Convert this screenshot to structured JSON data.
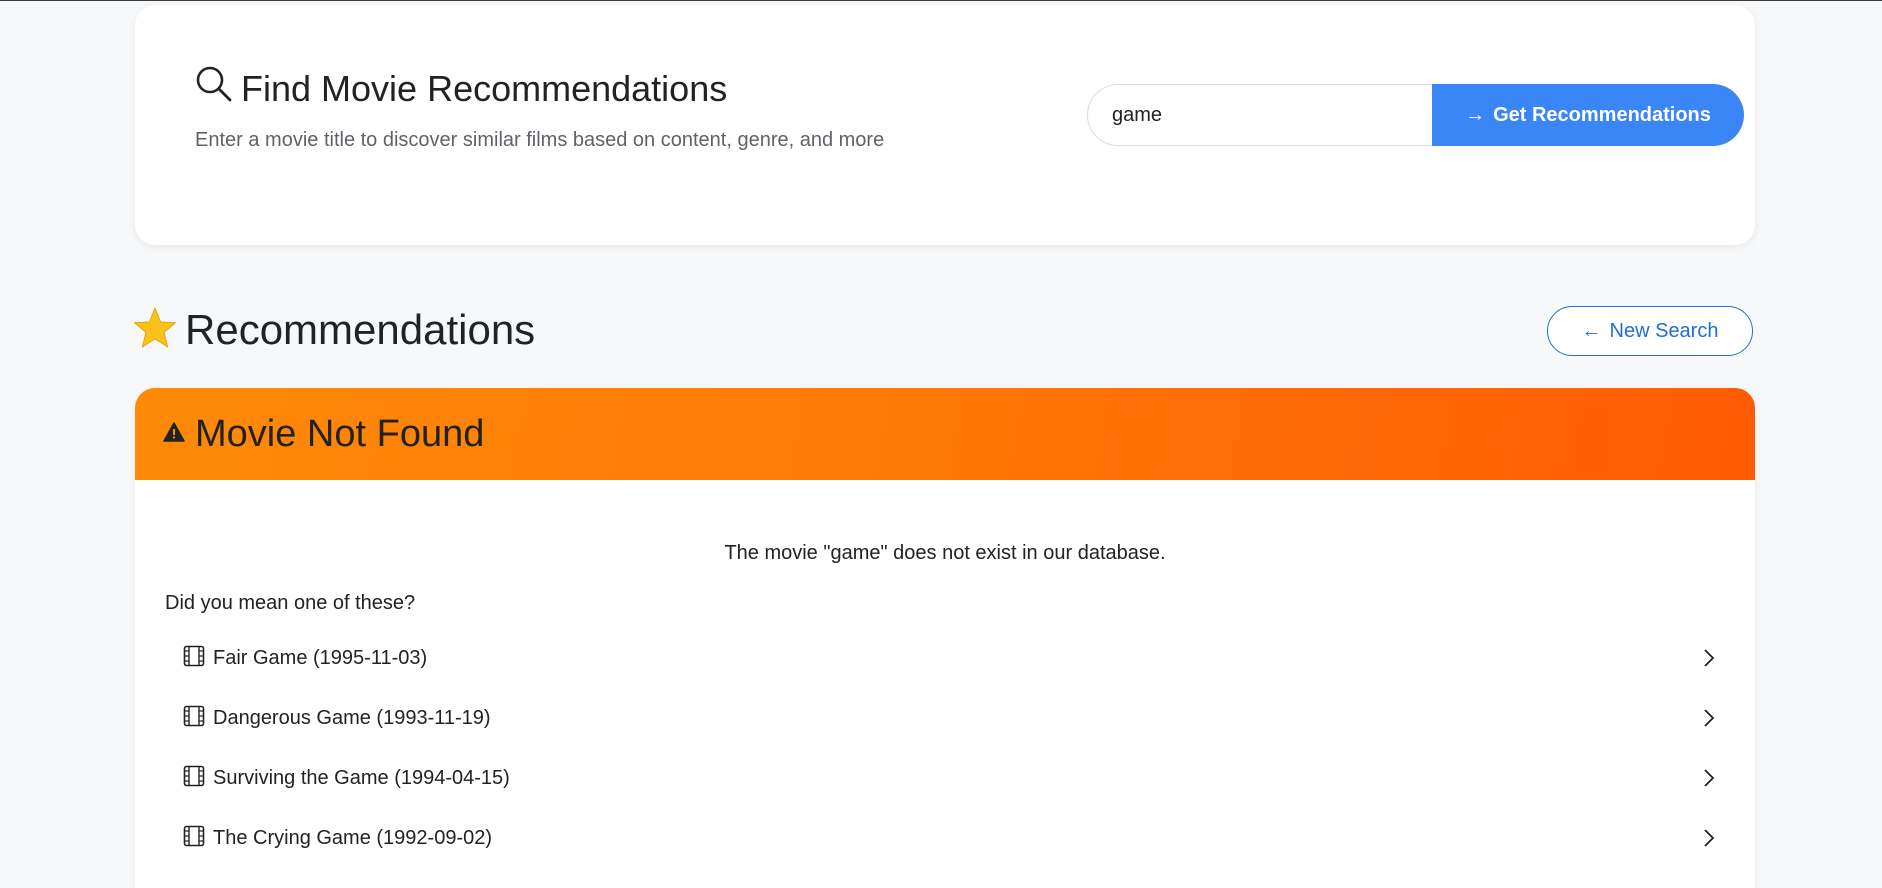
{
  "search": {
    "title": "Find Movie Recommendations",
    "subtitle": "Enter a movie title to discover similar films based on content, genre, and more",
    "input_value": "game",
    "button_arrow": "→",
    "button_label": "Get Recommendations"
  },
  "recommendations": {
    "title": "Recommendations",
    "new_search_arrow": "←",
    "new_search_label": "New Search"
  },
  "result": {
    "banner_title": "Movie Not Found",
    "message": "The movie \"game\" does not exist in our database.",
    "did_you_mean": "Did you mean one of these?",
    "suggestions": [
      {
        "label": "Fair Game (1995-11-03)"
      },
      {
        "label": "Dangerous Game (1993-11-19)"
      },
      {
        "label": "Surviving the Game (1994-04-15)"
      },
      {
        "label": "The Crying Game (1992-09-02)"
      }
    ]
  },
  "colors": {
    "accent": "#3b86f7",
    "link": "#1f6fd1",
    "banner_start": "#fe8a07",
    "banner_end": "#ff5a04",
    "star": "#f7c21a"
  }
}
